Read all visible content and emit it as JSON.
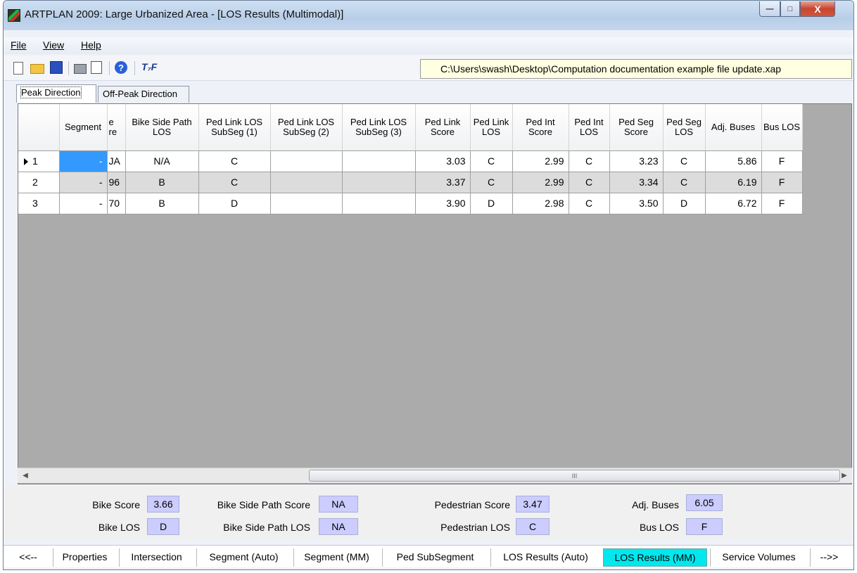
{
  "window": {
    "title": "ARTPLAN 2009: Large Urbanized Area - [LOS Results (Multimodal)]",
    "controls": {
      "minimize": "—",
      "maximize": "□",
      "close": "X"
    }
  },
  "menu": {
    "file": "File",
    "view": "View",
    "help": "Help"
  },
  "toolbar": {
    "icons": [
      "new-file-icon",
      "open-folder-icon",
      "save-icon",
      "print-icon",
      "print-preview-icon",
      "help-icon",
      "tf-icon"
    ],
    "help_glyph": "?",
    "tf_glyph": "T₇F",
    "file_path": "C:\\Users\\swash\\Desktop\\Computation documentation example file update.xap"
  },
  "direction_tabs": {
    "peak": "Peak Direction",
    "offpeak": "Off-Peak Direction"
  },
  "grid": {
    "headers": {
      "segment": "Segment",
      "clipped": "e\nre",
      "bike_side_path_los": "Bike Side Path LOS",
      "ped_link_subseg1": "Ped Link LOS SubSeg (1)",
      "ped_link_subseg2": "Ped Link LOS SubSeg (2)",
      "ped_link_subseg3": "Ped Link LOS SubSeg (3)",
      "ped_link_score": "Ped Link Score",
      "ped_link_los": "Ped Link LOS",
      "ped_int_score": "Ped Int Score",
      "ped_int_los": "Ped Int LOS",
      "ped_seg_score": "Ped Seg Score",
      "ped_seg_los": "Ped Seg LOS",
      "adj_buses": "Adj. Buses",
      "bus_los": "Bus LOS"
    },
    "rows": [
      {
        "num": "1",
        "segment": "-",
        "clipped": "JA",
        "bike_side_path_los": "N/A",
        "ped_link_subseg1": "C",
        "ped_link_subseg2": "",
        "ped_link_subseg3": "",
        "ped_link_score": "3.03",
        "ped_link_los": "C",
        "ped_int_score": "2.99",
        "ped_int_los": "C",
        "ped_seg_score": "3.23",
        "ped_seg_los": "C",
        "adj_buses": "5.86",
        "bus_los": "F"
      },
      {
        "num": "2",
        "segment": "-",
        "clipped": "96",
        "bike_side_path_los": "B",
        "ped_link_subseg1": "C",
        "ped_link_subseg2": "",
        "ped_link_subseg3": "",
        "ped_link_score": "3.37",
        "ped_link_los": "C",
        "ped_int_score": "2.99",
        "ped_int_los": "C",
        "ped_seg_score": "3.34",
        "ped_seg_los": "C",
        "adj_buses": "6.19",
        "bus_los": "F"
      },
      {
        "num": "3",
        "segment": "-",
        "clipped": "70",
        "bike_side_path_los": "B",
        "ped_link_subseg1": "D",
        "ped_link_subseg2": "",
        "ped_link_subseg3": "",
        "ped_link_score": "3.90",
        "ped_link_los": "D",
        "ped_int_score": "2.98",
        "ped_int_los": "C",
        "ped_seg_score": "3.50",
        "ped_seg_los": "D",
        "adj_buses": "6.72",
        "bus_los": "F"
      }
    ],
    "scroll_grip": "III"
  },
  "summary": {
    "bike_score_label": "Bike Score",
    "bike_score": "3.66",
    "bike_los_label": "Bike LOS",
    "bike_los": "D",
    "bike_side_path_score_label": "Bike Side Path Score",
    "bike_side_path_score": "NA",
    "bike_side_path_los_label": "Bike Side Path LOS",
    "bike_side_path_los": "NA",
    "pedestrian_score_label": "Pedestrian Score",
    "pedestrian_score": "3.47",
    "pedestrian_los_label": "Pedestrian LOS",
    "pedestrian_los": "C",
    "adj_buses_label": "Adj. Buses",
    "adj_buses": "6.05",
    "bus_los_label": "Bus LOS",
    "bus_los": "F"
  },
  "bottom_tabs": {
    "prev": "<<--",
    "properties": "Properties",
    "intersection": "Intersection",
    "segment_auto": "Segment (Auto)",
    "segment_mm": "Segment (MM)",
    "ped_subsegment": "Ped SubSegment",
    "los_auto": "LOS Results (Auto)",
    "los_mm": "LOS Results (MM)",
    "service_volumes": "Service Volumes",
    "next": "-->>"
  },
  "colors": {
    "active_tab": "#00e8ee",
    "summary_value_bg": "#ccccff",
    "selected_cell": "#3399ff",
    "grid_empty": "#ababab"
  }
}
